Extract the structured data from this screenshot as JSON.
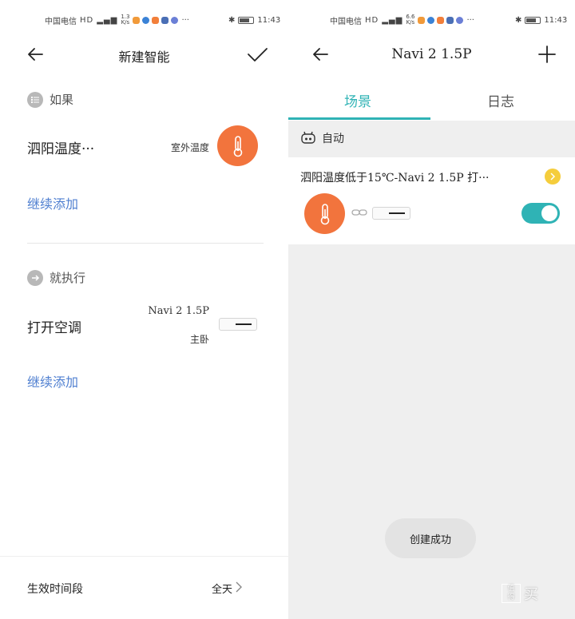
{
  "left": {
    "status": {
      "carrier": "中国电信",
      "net": "HD",
      "speed_top": "1.3",
      "speed_bottom": "K/s",
      "time": "11:43"
    },
    "title": "新建智能",
    "if_section": {
      "label": "如果"
    },
    "condition": {
      "label": "泗阳温度···",
      "sub": "室外温度"
    },
    "add_condition": "继续添加",
    "then_section": {
      "label": "就执行"
    },
    "action": {
      "label": "打开空调",
      "device": "Navi 2 1.5P",
      "room": "主卧"
    },
    "add_action": "继续添加",
    "period": {
      "label": "生效时间段",
      "value": "全天"
    }
  },
  "right": {
    "status": {
      "carrier": "中国电信",
      "net": "HD",
      "speed_top": "6.6",
      "speed_bottom": "K/s",
      "time": "11:43"
    },
    "title": "Navi 2 1.5P",
    "tabs": [
      {
        "label": "场景"
      },
      {
        "label": "日志"
      }
    ],
    "auto_label": "自动",
    "card": {
      "name": "泗阳温度低于15℃-Navi 2 1.5P 打···",
      "enabled": true
    },
    "toast": "创建成功"
  },
  "colors": {
    "accent": "#2fb3b5",
    "thermo": "#f2743d",
    "link": "#4f7fd0",
    "more": "#f5cd3c"
  },
  "icons": [
    "back-arrow-icon",
    "check-icon",
    "plus-icon",
    "list-icon",
    "arrow-right-circle-icon",
    "thermometer-icon",
    "link-icon",
    "robot-icon",
    "chevron-right-icon"
  ],
  "watermark": {
    "top": "值",
    "bottom": "得",
    "text": "买"
  }
}
